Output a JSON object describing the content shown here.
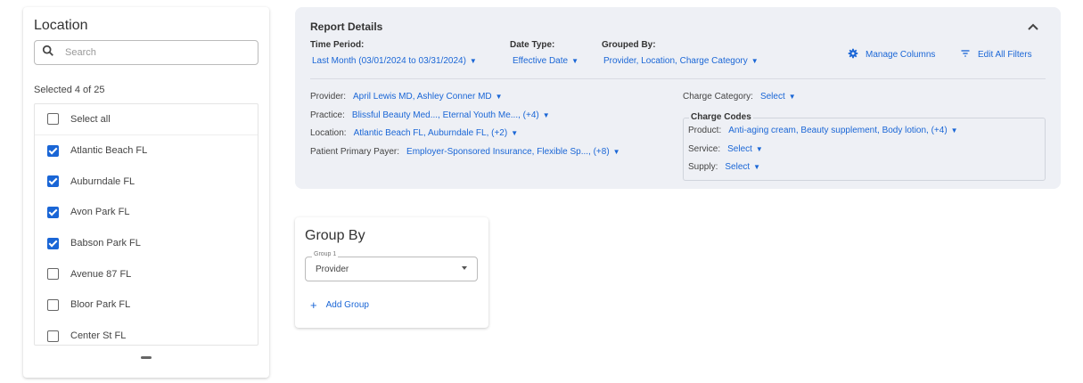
{
  "location_panel": {
    "title": "Location",
    "search_placeholder": "Search",
    "selected_count": "Selected 4 of 25",
    "select_all_label": "Select all",
    "items": [
      {
        "label": "Atlantic Beach FL",
        "checked": true
      },
      {
        "label": "Auburndale FL",
        "checked": true
      },
      {
        "label": "Avon Park FL",
        "checked": true
      },
      {
        "label": "Babson Park FL",
        "checked": true
      },
      {
        "label": "Avenue 87 FL",
        "checked": false
      },
      {
        "label": "Bloor Park FL",
        "checked": false
      },
      {
        "label": "Center St FL",
        "checked": false
      }
    ]
  },
  "report_details": {
    "title": "Report Details",
    "time_period_label": "Time Period:",
    "time_period_value": "Last Month (03/01/2024 to 03/31/2024)",
    "date_type_label": "Date Type:",
    "date_type_value": "Effective Date",
    "grouped_by_label": "Grouped By:",
    "grouped_by_value": "Provider, Location, Charge Category",
    "manage_columns_label": "Manage Columns",
    "edit_filters_label": "Edit All Filters",
    "provider_label": "Provider:",
    "provider_value": "April Lewis MD, Ashley Conner MD",
    "practice_label": "Practice:",
    "practice_value": "Blissful Beauty Med..., Eternal Youth Me..., (+4)",
    "location_label": "Location:",
    "location_value": "Atlantic Beach FL, Auburndale FL, (+2)",
    "payer_label": "Patient Primary Payer:",
    "payer_value": "Employer-Sponsored Insurance, Flexible Sp..., (+8)",
    "charge_category_label": "Charge Category:",
    "charge_category_value": "Select",
    "charge_codes_title": "Charge Codes",
    "product_label": "Product:",
    "product_value": "Anti-aging cream, Beauty supplement, Body lotion, (+4)",
    "service_label": "Service:",
    "service_value": "Select",
    "supply_label": "Supply:",
    "supply_value": "Select"
  },
  "group_by": {
    "title": "Group By",
    "select_label": "Group 1",
    "select_value": "Provider",
    "add_group_label": "Add Group"
  },
  "colors": {
    "accent": "#1a66d6",
    "panel_bg": "#eef0f5"
  }
}
